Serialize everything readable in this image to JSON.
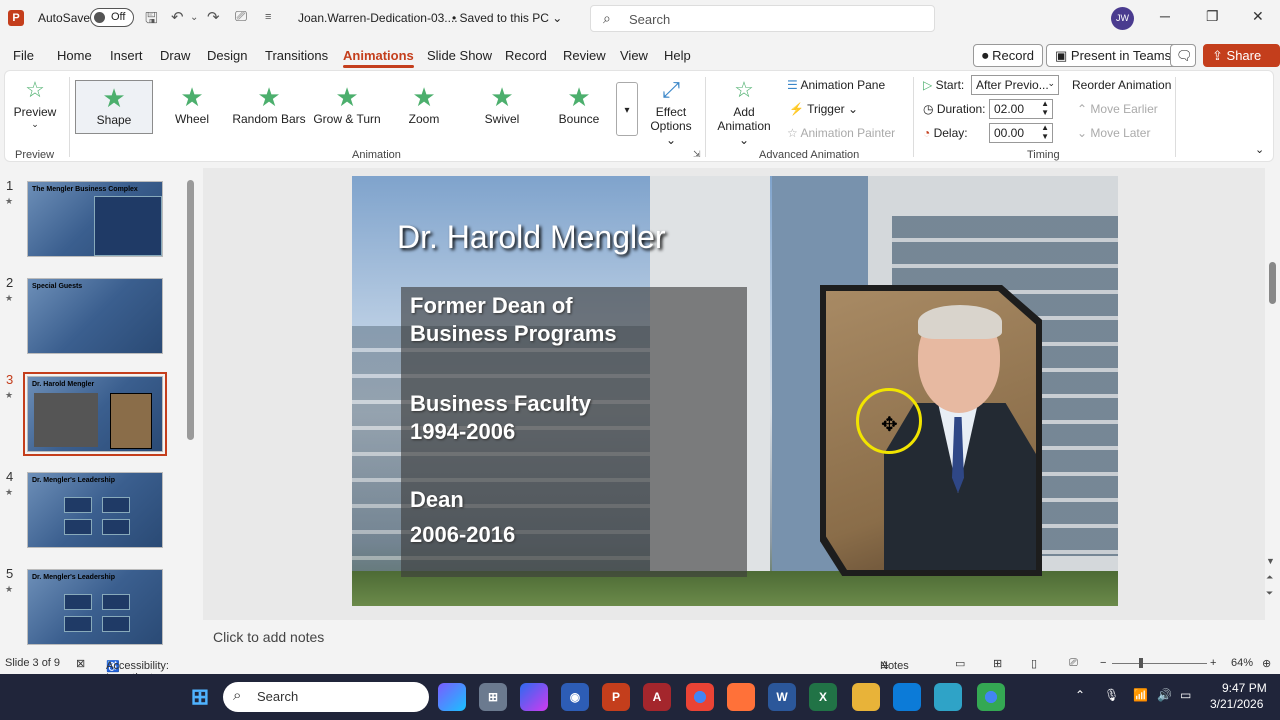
{
  "titlebar": {
    "app_badge": "P",
    "autosave_label": "AutoSave",
    "autosave_state": "Off",
    "doc_name": "Joan.Warren-Dedication-03....",
    "saved_status": "• Saved to this PC ⌄",
    "search_placeholder": "Search",
    "user_initials": "JW"
  },
  "menu": {
    "items": [
      "File",
      "Home",
      "Insert",
      "Draw",
      "Design",
      "Transitions",
      "Animations",
      "Slide Show",
      "Record",
      "Review",
      "View",
      "Help"
    ],
    "active": "Animations"
  },
  "top_buttons": {
    "record": "Record",
    "present": "Present in Teams",
    "share": "Share"
  },
  "ribbon": {
    "preview": {
      "label": "Preview",
      "group": "Preview"
    },
    "animation_gallery": [
      "Shape",
      "Wheel",
      "Random Bars",
      "Grow & Turn",
      "Zoom",
      "Swivel",
      "Bounce"
    ],
    "selected_animation": "Shape",
    "effect_options": [
      "Effect",
      "Options ⌄"
    ],
    "animation_group": "Animation",
    "add_animation": [
      "Add",
      "Animation ⌄"
    ],
    "animation_pane": "Animation Pane",
    "trigger": "Trigger ⌄",
    "animation_painter": "Animation Painter",
    "advanced_group": "Advanced Animation",
    "timing": {
      "start_label": "Start:",
      "start_value": "After Previo...",
      "duration_label": "Duration:",
      "duration_value": "02.00",
      "delay_label": "Delay:",
      "delay_value": "00.00",
      "group": "Timing"
    },
    "reorder": {
      "title": "Reorder Animation",
      "earlier": "Move Earlier",
      "later": "Move Later"
    }
  },
  "thumbnails": [
    {
      "num": "1",
      "title": "The Mengler Business Complex",
      "selected": false
    },
    {
      "num": "2",
      "title": "Special Guests",
      "selected": false
    },
    {
      "num": "3",
      "title": "Dr. Harold Mengler",
      "selected": true
    },
    {
      "num": "4",
      "title": "Dr. Mengler's Leadership",
      "selected": false
    },
    {
      "num": "5",
      "title": "Dr. Mengler's Leadership",
      "selected": false
    }
  ],
  "slide": {
    "title": "Dr. Harold Mengler",
    "line1a": "Former Dean of",
    "line1b": "Business Programs",
    "line2a": "Business Faculty",
    "line2b": "1994-2006",
    "line3a": "Dean",
    "line3b": "2006-2016"
  },
  "notes_placeholder": "Click to add notes",
  "status": {
    "slide_count": "Slide 3 of 9",
    "accessibility": "Accessibility: Investigate",
    "notes": "Notes",
    "zoom": "64%"
  },
  "taskbar": {
    "search": "Search",
    "time": "9:47 PM",
    "date": "3/21/2026"
  }
}
